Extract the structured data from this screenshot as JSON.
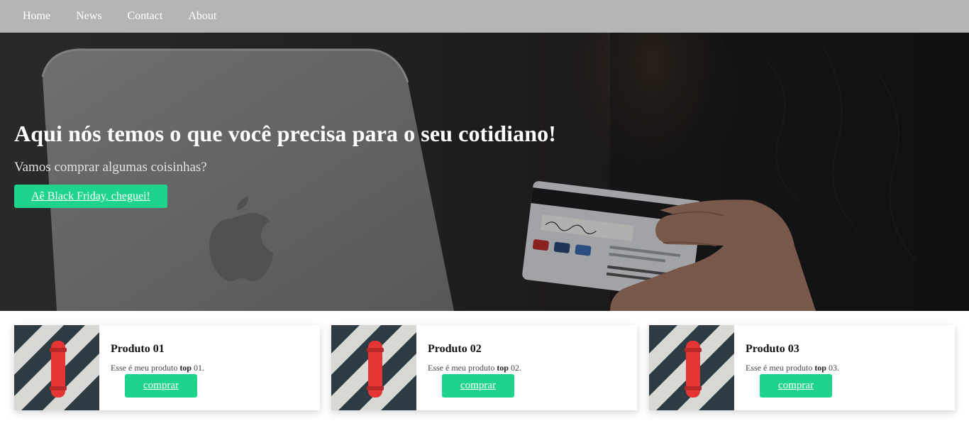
{
  "nav": {
    "items": [
      {
        "label": "Home"
      },
      {
        "label": "News"
      },
      {
        "label": "Contact"
      },
      {
        "label": "About"
      }
    ]
  },
  "hero": {
    "title": "Aqui nós temos o que você precisa para o seu cotidiano!",
    "subtitle": "Vamos comprar algumas coisinhas?",
    "cta_label": "Aê Black Friday, cheguei!"
  },
  "products": [
    {
      "name": "Produto 01",
      "desc_before": "Esse é meu produto ",
      "desc_bold": "top",
      "desc_after": " 01.",
      "button": "comprar"
    },
    {
      "name": "Produto 02",
      "desc_before": "Esse é meu produto ",
      "desc_bold": "top",
      "desc_after": " 02.",
      "button": "comprar"
    },
    {
      "name": "Produto 03",
      "desc_before": "Esse é meu produto ",
      "desc_bold": "top",
      "desc_after": " 03.",
      "button": "comprar"
    }
  ],
  "colors": {
    "nav_bg": "#b5b5b5",
    "accent": "#1ed48c"
  }
}
